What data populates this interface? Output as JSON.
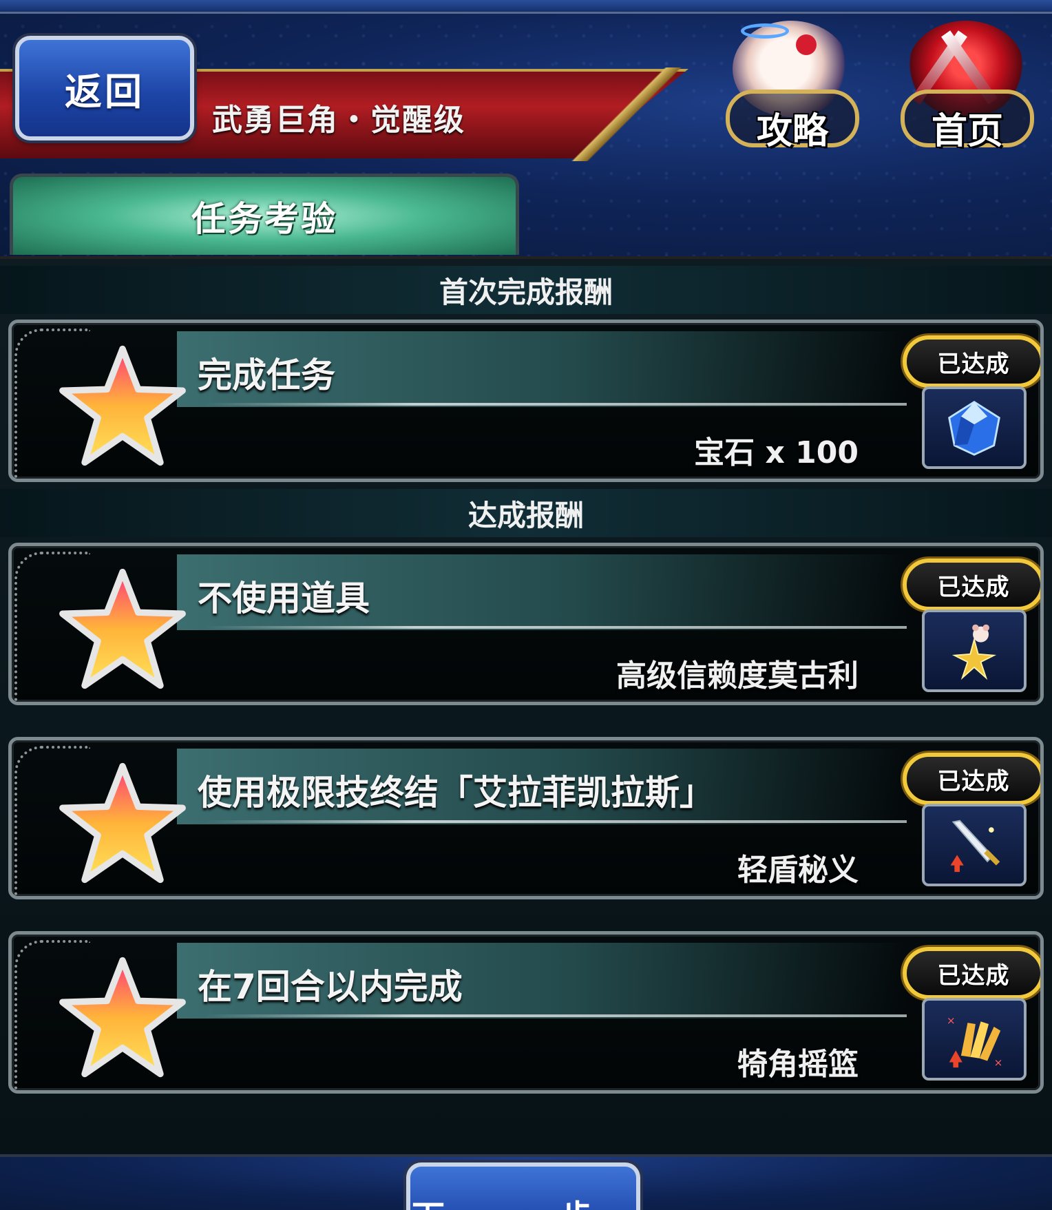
{
  "header": {
    "back_label": "返回",
    "title": "武勇巨角・觉醒级",
    "guide_label": "攻略",
    "home_label": "首页",
    "tab_label": "任务考验"
  },
  "sections": {
    "first_clear": "首次完成报酬",
    "achievement": "达成报酬"
  },
  "missions": [
    {
      "name": "完成任务",
      "reward": "宝石 x 100",
      "status": "已达成",
      "reward_icon": "gem-icon"
    },
    {
      "name": "不使用道具",
      "reward": "高级信赖度莫古利",
      "status": "已达成",
      "reward_icon": "moogle-star-icon"
    },
    {
      "name": "使用极限技终结「艾拉菲凯拉斯」",
      "reward": "轻盾秘义",
      "status": "已达成",
      "reward_icon": "sword-icon"
    },
    {
      "name": "在7回合以内完成",
      "reward": "犄角摇篮",
      "status": "已达成",
      "reward_icon": "cards-icon"
    }
  ],
  "footer": {
    "next_label": "下一步"
  },
  "colors": {
    "accent_gold": "#f1c93a",
    "button_blue": "#1d46a8",
    "tab_green": "#4ab891",
    "banner_red": "#b01d22"
  }
}
